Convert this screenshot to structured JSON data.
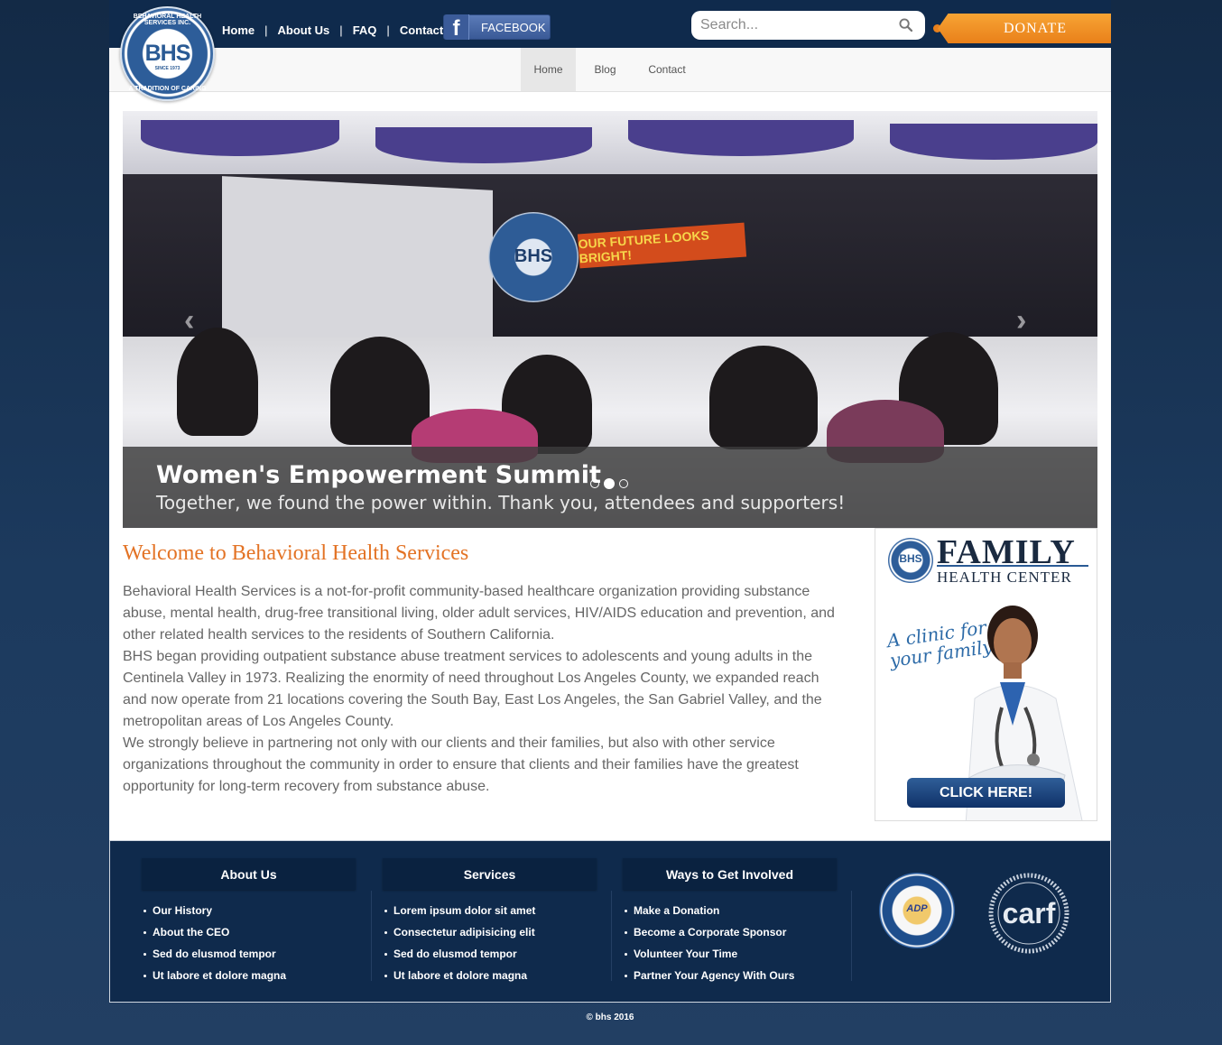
{
  "logo": {
    "text": "BHS",
    "ring_top": "BEHAVIORAL HEALTH SERVICES INC.",
    "ring_bottom": "A TRADITION OF CARING",
    "since": "SINCE 1973"
  },
  "top_nav": [
    "Home",
    "About Us",
    "FAQ",
    "Contact"
  ],
  "facebook": {
    "icon": "facebook-icon",
    "label": "FACEBOOK"
  },
  "search": {
    "placeholder": "Search...",
    "icon": "search-icon"
  },
  "donate": {
    "label": "DONATE"
  },
  "sub_nav": [
    {
      "label": "Home",
      "active": true
    },
    {
      "label": "Blog",
      "active": false
    },
    {
      "label": "Contact",
      "active": false
    }
  ],
  "slider": {
    "title": "Women's Empowerment Summit",
    "subtitle": "Together, we found the power within. Thank you, attendees and supporters!",
    "slide_count": 3,
    "active_index": 1,
    "photo_seal": "BHS",
    "photo_banner": "OUR FUTURE LOOKS BRIGHT!"
  },
  "welcome": {
    "title": "Welcome to Behavioral Health Services",
    "paragraphs": [
      "Behavioral Health Services is a not-for-profit community-based healthcare organization providing substance abuse, mental health, drug-free transitional living, older adult services, HIV/AIDS education and prevention, and other related health services to the residents of Southern California.",
      "BHS began providing outpatient substance abuse treatment services to adolescents and young adults in the Centinela Valley in 1973. Realizing the enormity of need throughout Los Angeles County, we expanded reach and now operate from 21 locations covering the South Bay, East Los Angeles, the San Gabriel Valley, and the metropolitan areas of Los Angeles County.",
      "We strongly believe in partnering not only with our clients and their families, but also with other service organizations throughout the community in order to ensure that clients and their families have the greatest opportunity for long-term recovery from substance abuse."
    ]
  },
  "ad": {
    "logo_text": "BHS",
    "family": "FAMILY",
    "health_center": "HEALTH CENTER",
    "script_line1": "A clinic for",
    "script_line2": "your family.",
    "button": "CLICK HERE!"
  },
  "footer": {
    "columns": [
      {
        "title": "About Us",
        "items": [
          "Our History",
          "About the CEO",
          "Sed do elusmod tempor",
          "Ut labore et dolore magna"
        ]
      },
      {
        "title": "Services",
        "items": [
          "Lorem ipsum dolor sit amet",
          "Consectetur adipisicing elit",
          "Sed do elusmod tempor",
          "Ut labore et dolore magna"
        ]
      },
      {
        "title": "Ways to Get Involved",
        "items": [
          "Make a Donation",
          "Become a Corporate Sponsor",
          "Volunteer Your Time",
          "Partner Your Agency With Ours"
        ]
      }
    ],
    "seal_adp": "ADP",
    "seal_carf": "carf",
    "copyright": "© bhs 2016"
  },
  "colors": {
    "navy": "#0f2a4c",
    "accent_orange": "#e37325",
    "donate_orange": "#f39a2c",
    "body_text": "#666666"
  }
}
